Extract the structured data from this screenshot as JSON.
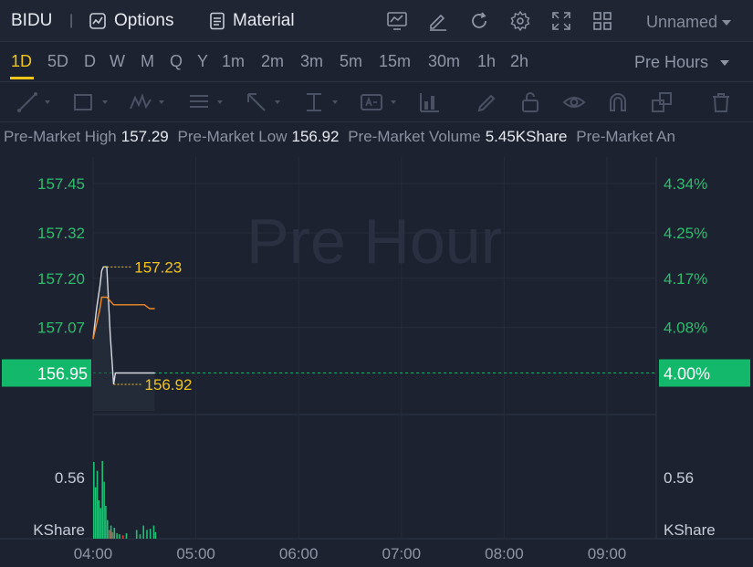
{
  "header": {
    "symbol": "BIDU",
    "separator": "|",
    "options_label": "Options",
    "material_label": "Material",
    "layout_name": "Unnamed",
    "icons": [
      "chart-indicator-icon",
      "draw-edit-icon",
      "refresh-icon",
      "settings-icon",
      "fullscreen-icon",
      "grid-layout-icon"
    ]
  },
  "timeframes": {
    "items": [
      "1D",
      "5D",
      "D",
      "W",
      "M",
      "Q",
      "Y",
      "1m",
      "2m",
      "3m",
      "5m",
      "15m",
      "30m",
      "1h",
      "2h"
    ],
    "active": "1D",
    "session_label": "Pre Hours"
  },
  "drawing_tools": [
    "line-tool-icon",
    "rectangle-tool-icon",
    "pattern-tool-icon",
    "fib-tool-icon",
    "arrow-tool-icon",
    "measure-tool-icon",
    "text-tool-icon",
    "bars-tool-icon",
    "brush-icon",
    "lock-icon",
    "eye-icon",
    "magnet-icon",
    "layers-icon",
    "trash-icon"
  ],
  "premarket": {
    "high_label": "Pre-Market High",
    "high_value": "157.29",
    "low_label": "Pre-Market Low",
    "low_value": "156.92",
    "volume_label": "Pre-Market Volume",
    "volume_value": "5.45KShare",
    "amount_label": "Pre-Market An"
  },
  "chart": {
    "watermark": "Pre Hour",
    "price_ticks": [
      "157.45",
      "157.32",
      "157.20",
      "157.07"
    ],
    "percent_ticks": [
      "4.34%",
      "4.25%",
      "4.17%",
      "4.08%"
    ],
    "current_price": "156.95",
    "current_percent": "4.00%",
    "high_marker": "157.23",
    "low_marker": "156.92",
    "volume_tick": "0.56",
    "volume_tick_right": "0.56",
    "volume_unit": "KShare",
    "volume_unit_right": "KShare",
    "time_ticks": [
      "04:00",
      "05:00",
      "06:00",
      "07:00",
      "08:00",
      "09:00"
    ],
    "colors": {
      "up": "#1fbf75",
      "down": "#e0453c",
      "price_line": "#d6d9e0",
      "avg_line": "#f08a24",
      "marker": "#f0c419",
      "axis_text_green": "#2ebd6e",
      "current_bg": "#14b86a"
    }
  },
  "chart_data": {
    "type": "line",
    "title": "",
    "xlabel": "",
    "ylabel": "",
    "ylim": [
      156.85,
      157.52
    ],
    "x": [
      "04:00",
      "04:02",
      "04:04",
      "04:05",
      "04:06",
      "04:08",
      "04:10",
      "04:12",
      "04:13",
      "04:14",
      "04:16",
      "04:18",
      "04:20",
      "04:22",
      "04:25",
      "04:28",
      "04:30",
      "04:33",
      "04:36"
    ],
    "series": [
      {
        "values": [
          157.04,
          157.12,
          157.18,
          157.22,
          157.23,
          157.23,
          157.05,
          156.92,
          156.95,
          156.95,
          156.95,
          156.95,
          156.95,
          156.95,
          156.95,
          156.95,
          156.95,
          156.95,
          156.95
        ]
      },
      {
        "values": [
          157.04,
          157.08,
          157.12,
          157.15,
          157.15,
          157.15,
          157.14,
          157.13,
          157.13,
          157.13,
          157.13,
          157.13,
          157.13,
          157.13,
          157.13,
          157.13,
          157.13,
          157.12,
          157.12
        ]
      }
    ],
    "volume": {
      "ylim": [
        0,
        1.1
      ],
      "bars": [
        {
          "t": 0.0,
          "v": 0.7,
          "dir": "up"
        },
        {
          "t": 1.0,
          "v": 0.47,
          "dir": "up"
        },
        {
          "t": 2.0,
          "v": 0.62,
          "dir": "up"
        },
        {
          "t": 3.0,
          "v": 0.35,
          "dir": "up"
        },
        {
          "t": 4.0,
          "v": 0.28,
          "dir": "up"
        },
        {
          "t": 5.0,
          "v": 0.71,
          "dir": "up"
        },
        {
          "t": 6.0,
          "v": 0.52,
          "dir": "up"
        },
        {
          "t": 7.0,
          "v": 0.3,
          "dir": "up"
        },
        {
          "t": 8.0,
          "v": 0.17,
          "dir": "up"
        },
        {
          "t": 9.0,
          "v": 0.08,
          "dir": "down"
        },
        {
          "t": 10.0,
          "v": 0.12,
          "dir": "up"
        },
        {
          "t": 11.0,
          "v": 0.06,
          "dir": "down"
        },
        {
          "t": 12.0,
          "v": 0.1,
          "dir": "up"
        },
        {
          "t": 13.5,
          "v": 0.05,
          "dir": "up"
        },
        {
          "t": 15.0,
          "v": 0.04,
          "dir": "up"
        },
        {
          "t": 17.0,
          "v": 0.03,
          "dir": "down"
        },
        {
          "t": 19.0,
          "v": 0.05,
          "dir": "up"
        },
        {
          "t": 25.0,
          "v": 0.08,
          "dir": "up"
        },
        {
          "t": 27.0,
          "v": 0.04,
          "dir": "up"
        },
        {
          "t": 29.0,
          "v": 0.12,
          "dir": "up"
        },
        {
          "t": 31.0,
          "v": 0.08,
          "dir": "up"
        },
        {
          "t": 33.0,
          "v": 0.09,
          "dir": "up"
        },
        {
          "t": 35.0,
          "v": 0.12,
          "dir": "up"
        },
        {
          "t": 36.0,
          "v": 0.06,
          "dir": "up"
        }
      ]
    }
  }
}
